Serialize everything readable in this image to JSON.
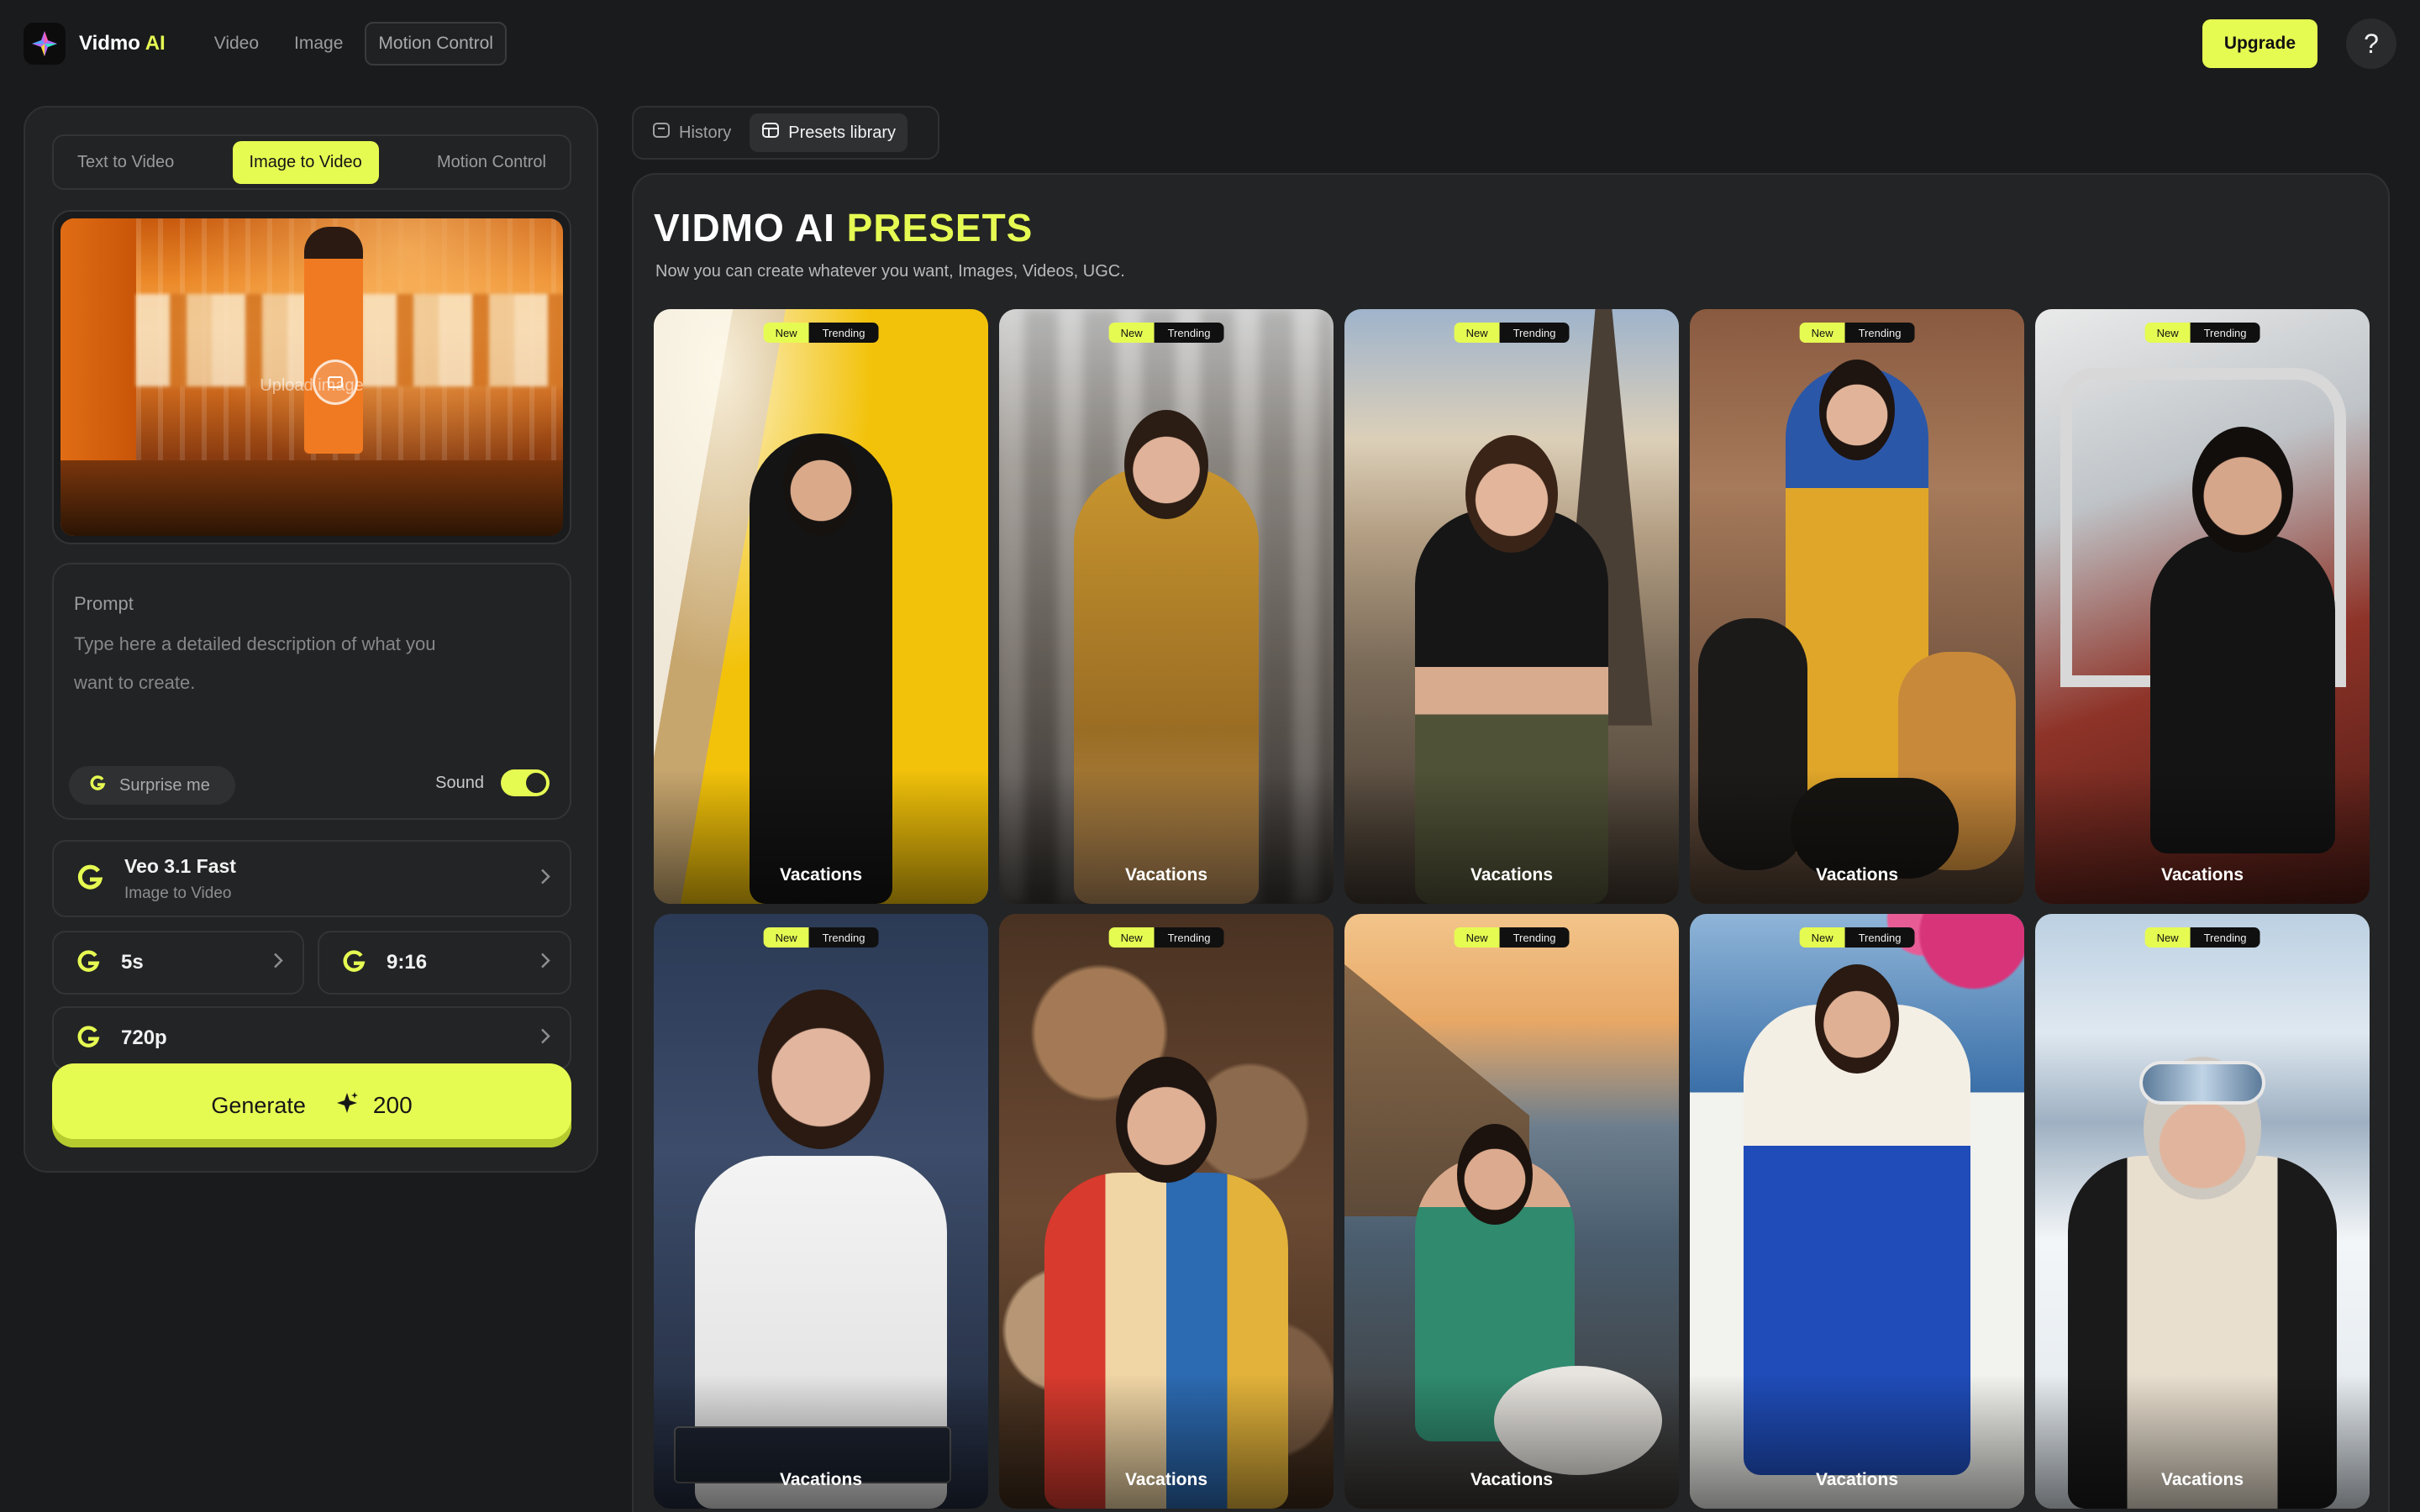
{
  "app": {
    "brand_name": "Vidmo",
    "brand_accent": "AI",
    "accent_color": "#e6fb52"
  },
  "topnav": {
    "items": [
      {
        "label": "Video"
      },
      {
        "label": "Image"
      },
      {
        "label": "Motion Control"
      }
    ],
    "upgrade_label": "Upgrade",
    "help_label": "?"
  },
  "left": {
    "tabs": [
      {
        "label": "Text to Video"
      },
      {
        "label": "Image to Video"
      },
      {
        "label": "Motion Control"
      }
    ],
    "upload_label": "Upload image",
    "prompt": {
      "label": "Prompt",
      "placeholder": "Type here a detailed description of what you want to create.",
      "surprise_label": "Surprise me",
      "sound_label": "Sound",
      "sound_on": true
    },
    "model": {
      "name": "Veo 3.1 Fast",
      "mode": "Image to Video"
    },
    "duration": "5s",
    "aspect_ratio": "9:16",
    "resolution": "720p",
    "generate_label": "Generate",
    "generate_cost": "200"
  },
  "right": {
    "tabs": [
      {
        "label": "History",
        "icon": "history-icon"
      },
      {
        "label": "Presets library",
        "icon": "library-icon"
      }
    ],
    "title_part1": "VIDMO AI",
    "title_part2": "PRESETS",
    "subtitle": "Now you can create whatever you want, Images, Videos, UGC.",
    "badge_new": "New",
    "badge_trending": "Trending",
    "presets": [
      {
        "label": "Vacations"
      },
      {
        "label": "Vacations"
      },
      {
        "label": "Vacations"
      },
      {
        "label": "Vacations"
      },
      {
        "label": "Vacations"
      },
      {
        "label": "Vacations"
      },
      {
        "label": "Vacations"
      },
      {
        "label": "Vacations"
      },
      {
        "label": "Vacations"
      },
      {
        "label": "Vacations"
      }
    ]
  }
}
